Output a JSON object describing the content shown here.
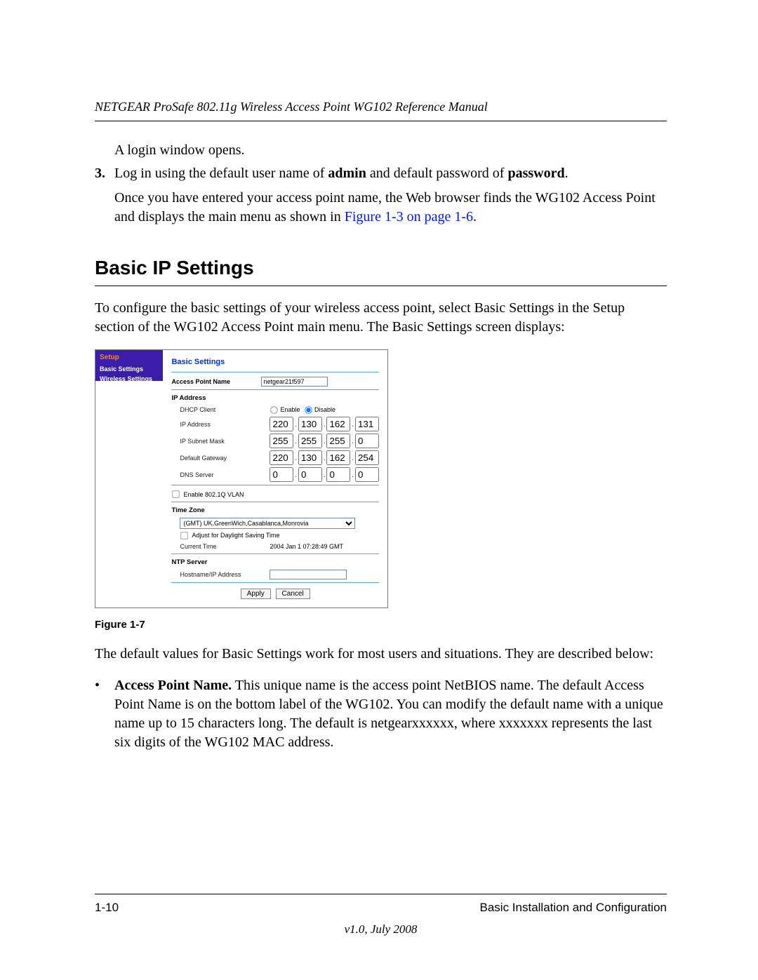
{
  "header": {
    "running": "NETGEAR ProSafe 802.11g Wireless Access Point WG102 Reference Manual"
  },
  "intro": {
    "login_opens": "A login window opens.",
    "step3_num": "3.",
    "step3_a": "Log in using the default user name of ",
    "step3_admin": "admin",
    "step3_b": " and default password of ",
    "step3_pwd": "password",
    "step3_c": ".",
    "after_a": "Once you have entered your access point name, the Web browser finds the WG102 Access Point and displays the main menu as shown in ",
    "after_link": "Figure 1-3 on page 1-6",
    "after_b": "."
  },
  "section_title": "Basic IP Settings",
  "lead": "To configure the basic settings of your wireless access point, select Basic Settings in the Setup section of the WG102 Access Point main menu. The Basic Settings screen displays:",
  "figure": {
    "sidebar": {
      "header": "Setup",
      "items": [
        "Basic Settings",
        "Wireless Settings"
      ]
    },
    "panel_title": "Basic Settings",
    "ap_name": {
      "label": "Access Point Name",
      "value": "netgear21f597"
    },
    "ip_section": "IP Address",
    "dhcp": {
      "label": "DHCP Client",
      "enable": "Enable",
      "disable": "Disable",
      "selected": "disable"
    },
    "ip": {
      "label": "IP Address",
      "o": [
        "220",
        "130",
        "162",
        "131"
      ]
    },
    "mask": {
      "label": "IP Subnet Mask",
      "o": [
        "255",
        "255",
        "255",
        "0"
      ]
    },
    "gw": {
      "label": "Default Gateway",
      "o": [
        "220",
        "130",
        "162",
        "254"
      ]
    },
    "dns": {
      "label": "DNS Server",
      "o": [
        "0",
        "0",
        "0",
        "0"
      ]
    },
    "vlan_label": "Enable 802.1Q VLAN",
    "tz_section": "Time Zone",
    "tz_value": "(GMT) UK,GreenWich,Casablanca,Monrovia",
    "daylight_label": "Adjust for Daylight Saving Time",
    "curtime_label": "Current Time",
    "curtime_value": "2004 Jan 1 07:28:49 GMT",
    "ntp_section": "NTP Server",
    "ntp_label": "Hostname/IP Address",
    "ntp_value": "",
    "btn_apply": "Apply",
    "btn_cancel": "Cancel"
  },
  "caption": "Figure 1-7",
  "after_fig": "The default values for Basic Settings work for most users and situations. They are described below:",
  "bullet": {
    "lead_bold": "Access Point Name.",
    "rest": " This unique name is the access point NetBIOS name. The default Access Point Name is on the bottom label of the WG102. You can modify the default name with a unique name up to 15 characters long. The default is netgearxxxxxx, where xxxxxxx represents the last six digits of the WG102 MAC address."
  },
  "footer": {
    "left": "1-10",
    "right": "Basic Installation and Configuration",
    "version": "v1.0, July 2008"
  }
}
